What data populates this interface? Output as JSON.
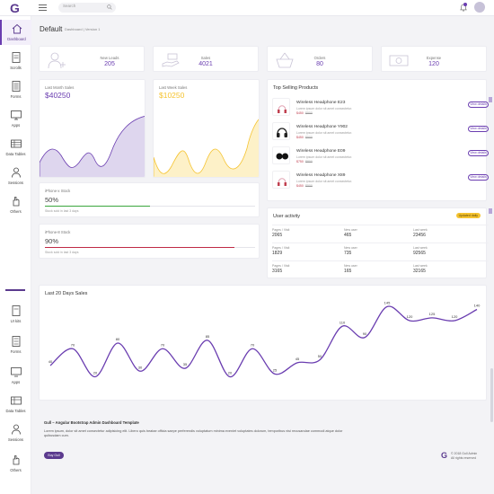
{
  "app": {
    "logo_letter": "G",
    "search_placeholder": "Search",
    "accent": "#6a3db0",
    "notification_badge": "2"
  },
  "sidebar": {
    "items": [
      {
        "label": "Dashboard",
        "icon": "home-icon",
        "active": true
      },
      {
        "label": "Scrolls",
        "icon": "document-icon"
      },
      {
        "label": "Forms",
        "icon": "form-icon"
      },
      {
        "label": "Apps",
        "icon": "monitor-icon"
      },
      {
        "label": "Data Tables",
        "icon": "table-icon"
      },
      {
        "label": "Sessions",
        "icon": "user-icon"
      },
      {
        "label": "Others",
        "icon": "hand-icon"
      }
    ],
    "items_lower": [
      {
        "label": "UI kits",
        "icon": "document-icon"
      },
      {
        "label": "Forms",
        "icon": "form-icon"
      },
      {
        "label": "Apps",
        "icon": "monitor-icon"
      },
      {
        "label": "Data Tables",
        "icon": "table-icon"
      },
      {
        "label": "Sessions",
        "icon": "user-icon"
      },
      {
        "label": "Others",
        "icon": "hand-icon"
      }
    ]
  },
  "header": {
    "title": "Default",
    "breadcrumb": "Dashboard  |  Version 1"
  },
  "stats": [
    {
      "label": "New Leads",
      "value": "205",
      "icon": "user-add-icon"
    },
    {
      "label": "Sales",
      "value": "4021",
      "icon": "money-hand-icon"
    },
    {
      "label": "Orders",
      "value": "80",
      "icon": "basket-icon"
    },
    {
      "label": "Expense",
      "value": "120",
      "icon": "banknote-icon"
    }
  ],
  "sales": [
    {
      "label": "Last Month Sales",
      "value": "$40250",
      "color": "#6a3db0"
    },
    {
      "label": "Last Week Sales",
      "value": "$10250",
      "color": "#f5c330"
    }
  ],
  "progress": [
    {
      "label": "iPhone-x Stock",
      "value": "50%",
      "percent": 50,
      "note": "Stock sold in last 3 days",
      "color": "#3aa63e"
    },
    {
      "label": "iPhone-8 Stock",
      "value": "90%",
      "percent": 90,
      "note": "Stock sold in last 3 days",
      "color": "#c02a45"
    }
  ],
  "products": {
    "title": "Top Selling Products",
    "button_label": "View details",
    "items": [
      {
        "name": "Wireless Headphone E23",
        "desc": "Lorem ipsum dolor sit amet consectetur.",
        "price": "$450",
        "old": "$500"
      },
      {
        "name": "Wireless Headphone Y902",
        "desc": "Lorem ipsum dolor sit amet consectetur.",
        "price": "$450",
        "old": "$500"
      },
      {
        "name": "Wireless Headphone E09",
        "desc": "Lorem ipsum dolor sit amet consectetur.",
        "price": "$750",
        "old": "$800"
      },
      {
        "name": "Wireless Headphone X89",
        "desc": "Lorem ipsum dolor sit amet consectetur.",
        "price": "$450",
        "old": "$500"
      }
    ]
  },
  "activity": {
    "title": "User activity",
    "badge": "Updated daily",
    "rows": [
      [
        {
          "k": "Pages / Visit",
          "v": "2065"
        },
        {
          "k": "New user",
          "v": "465"
        },
        {
          "k": "Last week",
          "v": "23456"
        }
      ],
      [
        {
          "k": "Pages / Visit",
          "v": "1829"
        },
        {
          "k": "New user",
          "v": "735"
        },
        {
          "k": "Last week",
          "v": "92565"
        }
      ],
      [
        {
          "k": "Pages / Visit",
          "v": "3165"
        },
        {
          "k": "New user",
          "v": "165"
        },
        {
          "k": "Last week",
          "v": "32165"
        }
      ]
    ]
  },
  "chart_data": {
    "type": "line",
    "title": "Last 20 Days Sales",
    "series": [
      {
        "values": [
          40,
          70,
          20,
          80,
          30,
          70,
          35,
          85,
          20,
          70,
          25,
          45,
          50,
          110,
          90,
          145,
          120,
          125,
          120,
          140
        ]
      }
    ],
    "labels": [
      "40",
      "70",
      "20",
      "80",
      "30",
      "70",
      "35",
      "85",
      "20",
      "70",
      "25",
      "45",
      "50",
      "110",
      "90",
      "145",
      "120",
      "125",
      "120",
      "140"
    ],
    "color": "#6a3db0",
    "ylim": [
      0,
      160
    ],
    "grid": false
  },
  "footer": {
    "title": "Gull – Angular Bootstrap Admin Dashboard Template",
    "text": "Lorem ipsum, dolor sit amet consectetur adipisicing elit. Libero quis beatae officia saepe perferendis voluptatum minima eveniet voluptates dolorum, temporibus nisi recusandae commodi atque dolor quibusdam cum.",
    "button": "Buy Gull",
    "logo": "G",
    "copyright": "© 2018 Gull Admin",
    "rights": "All rights reserved"
  }
}
